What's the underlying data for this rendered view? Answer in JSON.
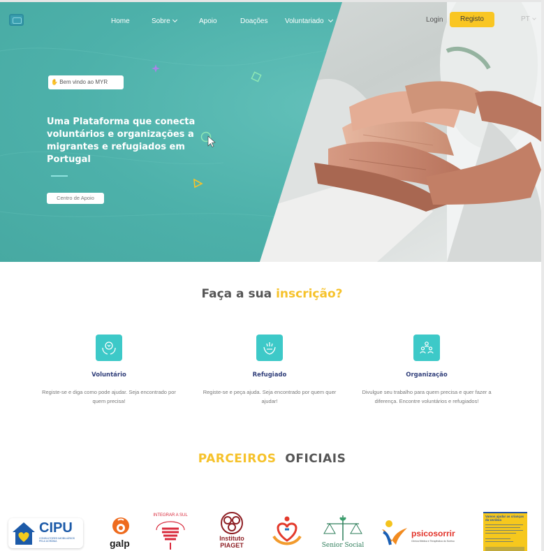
{
  "nav": {
    "items": [
      {
        "label": "Home",
        "dropdown": false
      },
      {
        "label": "Sobre",
        "dropdown": true
      },
      {
        "label": "Apoio",
        "dropdown": false
      },
      {
        "label": "Doações",
        "dropdown": false
      },
      {
        "label": "Voluntariado",
        "dropdown": true
      }
    ],
    "login": "Login",
    "register": "Registo",
    "language": "PT"
  },
  "hero": {
    "welcome_badge": "Bem vindo ao  MYR",
    "title": "Uma Plataforma que conecta voluntários e organizações a migrantes e refugiados em Portugal",
    "cta": "Centro de Apoio"
  },
  "signup": {
    "title_prefix": "Faça a sua ",
    "title_highlight": "inscrição?",
    "cards": [
      {
        "title": "Voluntário",
        "description": "Registe-se e diga como pode ajudar. Seja encontrado por quem precisa!",
        "icon": "volunteer-hands-icon"
      },
      {
        "title": "Refugiado",
        "description": "Registe-se e peça ajuda. Seja encontrado por quem quer ajudar!",
        "icon": "refugee-hands-icon"
      },
      {
        "title": "Organização",
        "description": "Divulgue seu trabalho para quem precisa e quer fazer a diferença. Encontre voluntários e refugiados!",
        "icon": "organization-people-icon"
      }
    ]
  },
  "partners": {
    "title_highlight": "PARCEIROS",
    "title_rest": "OFICIAIS",
    "logos": [
      {
        "name": "CIPU",
        "caption": "CONSULTORES IMOBILIÁRIOS PELA UCRÂNIA"
      },
      {
        "name": "galp"
      },
      {
        "name": "INTEGRAR A SUL"
      },
      {
        "name": "Instituto PIAGET"
      },
      {
        "name": "heart-hands"
      },
      {
        "name": "Senior Social"
      },
      {
        "name": "psicosorrir",
        "caption": "Clínica Médica e Terapêutica do Sorriso"
      },
      {
        "name": "Vamos ajudar as crianças da Ucrânia"
      }
    ]
  },
  "colors": {
    "hero_teal": "#4fb4ad",
    "accent_yellow": "#f9c623",
    "icon_teal": "#3dc9c8",
    "card_title": "#32407b"
  }
}
